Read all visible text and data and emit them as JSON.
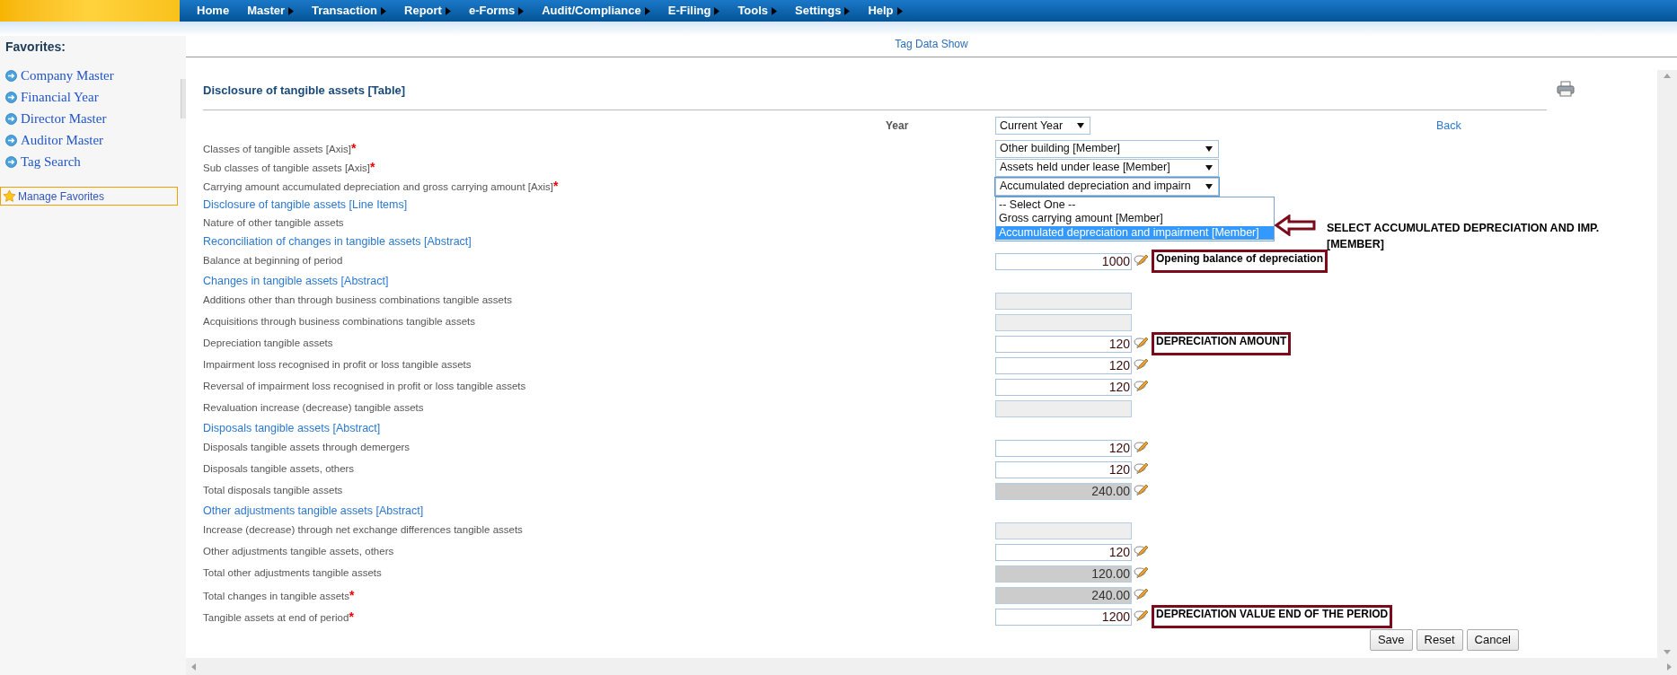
{
  "menu": [
    {
      "label": "Home",
      "has_submenu": false
    },
    {
      "label": "Master",
      "has_submenu": true
    },
    {
      "label": "Transaction",
      "has_submenu": true
    },
    {
      "label": "Report",
      "has_submenu": true
    },
    {
      "label": "e-Forms",
      "has_submenu": true
    },
    {
      "label": "Audit/Compliance",
      "has_submenu": true
    },
    {
      "label": "E-Filing",
      "has_submenu": true
    },
    {
      "label": "Tools",
      "has_submenu": true
    },
    {
      "label": "Settings",
      "has_submenu": true
    },
    {
      "label": "Help",
      "has_submenu": true
    }
  ],
  "sidebar": {
    "title": "Favorites:",
    "items": [
      "Company Master",
      "Financial Year",
      "Director Master",
      "Auditor Master",
      "Tag Search"
    ],
    "manage": "Manage Favorites"
  },
  "page_title": "Tag Data Show",
  "panel": {
    "title": "Disclosure of tangible assets [Table]",
    "year": {
      "label": "Year",
      "value": "Current Year"
    },
    "back": "Back",
    "rows": [
      {
        "kind": "select",
        "label": "Classes of tangible assets [Axis]",
        "required_mark": "*",
        "value": "Other building [Member]",
        "expanded": false
      },
      {
        "kind": "select",
        "label": "Sub classes of tangible assets [Axis]",
        "required_mark": "*",
        "value": "Assets held under lease [Member]",
        "expanded": false
      },
      {
        "kind": "select",
        "label": "Carrying amount accumulated depreciation and gross carrying amount [Axis]",
        "required_mark": "*",
        "value": "Accumulated depreciation and impairn",
        "expanded": true,
        "options": [
          {
            "label": "-- Select One --",
            "selected": false
          },
          {
            "label": "Gross carrying amount [Member]",
            "selected": false
          },
          {
            "label": "Accumulated depreciation and impairment [Member]",
            "selected": true
          }
        ],
        "callout": "SELECT ACCUMULATED DEPRECIATION AND IMP. [MEMBER]"
      },
      {
        "kind": "heading",
        "label": "Disclosure of tangible assets [Line Items]"
      },
      {
        "kind": "text",
        "label": "Nature of other tangible assets"
      },
      {
        "kind": "heading",
        "label": "Reconciliation of changes in tangible assets [Abstract]"
      },
      {
        "kind": "input",
        "label": "Balance at beginning of period",
        "value": "1000",
        "note": "Opening balance of depreciation"
      },
      {
        "kind": "heading",
        "label": "Changes in tangible assets [Abstract]"
      },
      {
        "kind": "empty",
        "label": "Additions other than through business combinations tangible assets"
      },
      {
        "kind": "empty",
        "label": "Acquisitions through business combinations tangible assets"
      },
      {
        "kind": "input",
        "label": "Depreciation tangible assets",
        "value": "120",
        "note": "DEPRECIATION AMOUNT"
      },
      {
        "kind": "input",
        "label": "Impairment loss recognised in profit or loss tangible assets",
        "value": "120"
      },
      {
        "kind": "input",
        "label": "Reversal of impairment loss recognised in profit or loss tangible assets",
        "value": "120"
      },
      {
        "kind": "empty",
        "label": "Revaluation increase (decrease) tangible assets"
      },
      {
        "kind": "heading",
        "label": "Disposals tangible assets [Abstract]"
      },
      {
        "kind": "input",
        "label": "Disposals tangible assets through demergers",
        "value": "120"
      },
      {
        "kind": "input",
        "label": "Disposals tangible assets, others",
        "value": "120"
      },
      {
        "kind": "total",
        "label": "Total disposals tangible assets",
        "value": "240.00"
      },
      {
        "kind": "heading",
        "label": "Other adjustments tangible assets [Abstract]"
      },
      {
        "kind": "empty",
        "label": "Increase (decrease) through net exchange differences tangible assets"
      },
      {
        "kind": "input",
        "label": "Other adjustments tangible assets, others",
        "value": "120"
      },
      {
        "kind": "total",
        "label": "Total other adjustments tangible assets",
        "value": "120.00"
      },
      {
        "kind": "total",
        "label": "Total changes in tangible assets",
        "required_mark": "*",
        "value": "240.00"
      },
      {
        "kind": "input",
        "label": "Tangible assets at end of period",
        "required_mark": "*",
        "value": "1200",
        "note": "DEPRECIATION VALUE END OF THE PERIOD"
      }
    ]
  },
  "buttons": [
    "Save",
    "Reset",
    "Cancel"
  ]
}
